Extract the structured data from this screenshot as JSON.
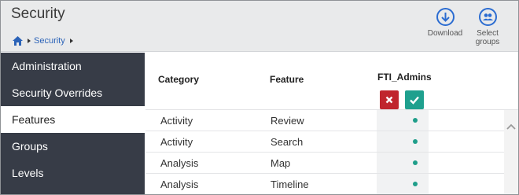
{
  "header": {
    "title": "Security",
    "breadcrumb": {
      "home_icon": "home-icon",
      "current": "Security"
    },
    "toolbar": {
      "download": {
        "label": "Download",
        "icon": "download-icon"
      },
      "select_groups": {
        "label_line1": "Select",
        "label_line2": "groups",
        "icon": "groups-icon"
      }
    }
  },
  "sidebar": {
    "items": [
      {
        "label": "Administration",
        "active": false
      },
      {
        "label": "Security Overrides",
        "active": false
      },
      {
        "label": "Features",
        "active": true
      },
      {
        "label": "Groups",
        "active": false
      },
      {
        "label": "Levels",
        "active": false
      }
    ]
  },
  "table": {
    "columns": {
      "category": "Category",
      "feature": "Feature",
      "group": "FTI_Admins"
    },
    "rows": [
      {
        "category": "Activity",
        "feature": "Review",
        "allowed": true
      },
      {
        "category": "Activity",
        "feature": "Search",
        "allowed": true
      },
      {
        "category": "Analysis",
        "feature": "Map",
        "allowed": true
      },
      {
        "category": "Analysis",
        "feature": "Timeline",
        "allowed": true
      }
    ]
  },
  "colors": {
    "accent": "#2b6cd1",
    "sidebar_bg": "#373c47",
    "deny": "#c0252d",
    "allow": "#1fa08e",
    "annotation_arrow": "#f28a1a"
  }
}
